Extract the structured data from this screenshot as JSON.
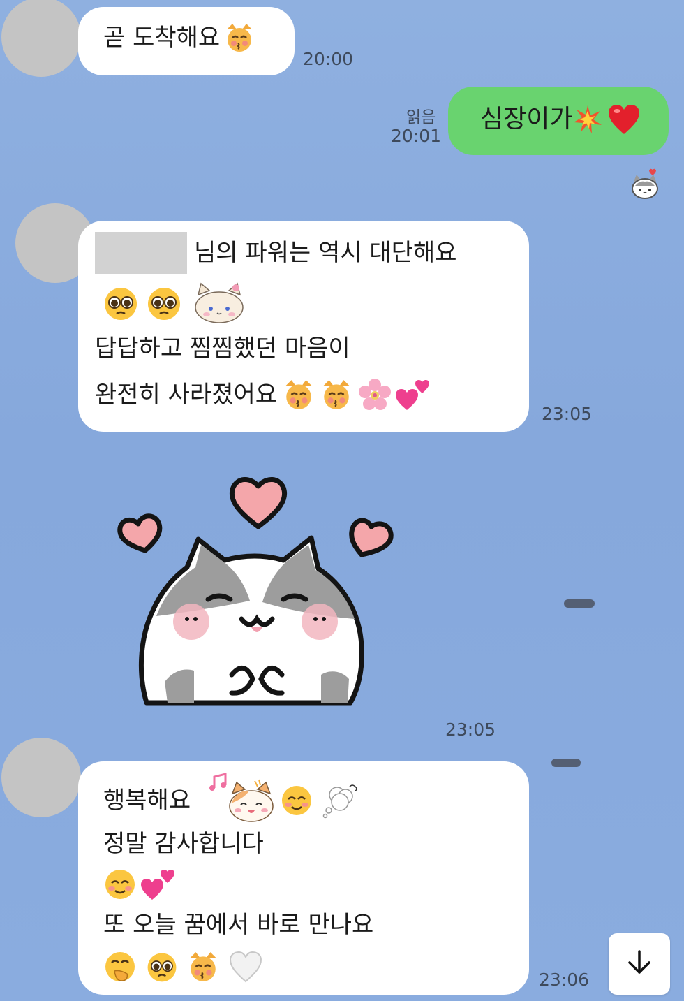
{
  "messages": {
    "m1": {
      "text": "곧 도착해요",
      "time": "20:00"
    },
    "m2": {
      "text": "심장이가",
      "read_label": "읽음",
      "time": "20:01"
    },
    "m3": {
      "line1": "님의 파워는 역시 대단해요",
      "line3": "답답하고 찜찜했던 마음이",
      "line4": "완전히 사라졌어요",
      "time": "23:05"
    },
    "m4": {
      "time": "23:05"
    },
    "m5": {
      "line1": "행복해요",
      "line2": "정말 감사합니다",
      "line4": "또 오늘 꿈에서 바로 만나요",
      "time": "23:06"
    }
  },
  "icons": {
    "scroll_down": "arrow-down-icon",
    "sticker": "cat-heart-sticker"
  },
  "colors": {
    "background": "#8aacdf",
    "my_bubble": "#69d36f",
    "other_bubble": "#ffffff",
    "avatar_placeholder": "#c4c4c4"
  }
}
